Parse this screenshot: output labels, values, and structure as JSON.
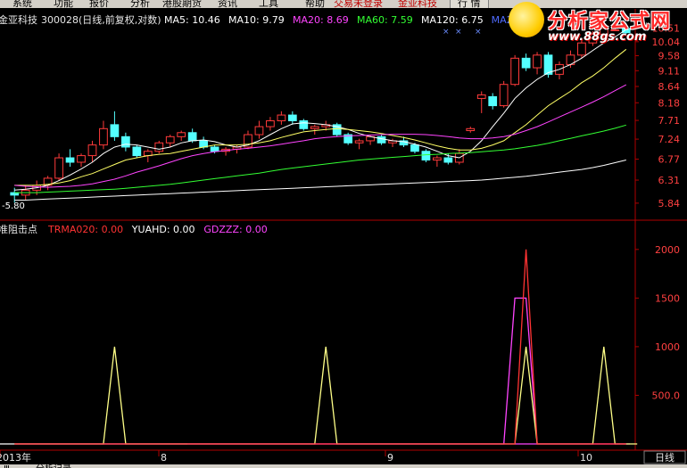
{
  "menu": [
    {
      "label": "系统",
      "x": 14
    },
    {
      "label": "功能",
      "x": 60
    },
    {
      "label": "报价",
      "x": 100
    },
    {
      "label": "分析",
      "x": 146
    },
    {
      "label": "港股期货",
      "x": 182
    },
    {
      "label": "资讯",
      "x": 244
    },
    {
      "label": "工具",
      "x": 290
    },
    {
      "label": "帮助",
      "x": 342
    },
    {
      "label": "交易未登录",
      "x": 374,
      "style": "red"
    },
    {
      "label": "金亚科技",
      "x": 446,
      "style": "red"
    },
    {
      "label": "行 情",
      "x": 504,
      "style": "box"
    }
  ],
  "main_header": {
    "stock": "金亚科技",
    "code_info": "300028(日线,前复权,对数)",
    "items": [
      {
        "label": "MA5: 10.46",
        "color": "#ffffff"
      },
      {
        "label": "MA10: 9.79",
        "color": "#ffffff"
      },
      {
        "label": "MA20: 8.69",
        "color": "#ff44ff"
      },
      {
        "label": "MA60: 7.59",
        "color": "#33ff33"
      },
      {
        "label": "MA120: 6.75",
        "color": "#ffffff"
      },
      {
        "label": "MA250",
        "color": "#4f6bff"
      }
    ]
  },
  "sub_header": {
    "title": "准阻击点",
    "items": [
      {
        "label": "TRMA020: 0.00",
        "color": "#ff3333"
      },
      {
        "label": "YUAHD: 0.00",
        "color": "#ffffff"
      },
      {
        "label": "GDZZZ: 0.00",
        "color": "#ff44ff"
      }
    ]
  },
  "price_axis": [
    "10.51",
    "10.04",
    "9.58",
    "9.11",
    "8.64",
    "8.18",
    "7.71",
    "7.24",
    "6.77",
    "6.31",
    "5.84"
  ],
  "price_low_label": "5.80",
  "ind_axis": [
    "2000",
    "1500",
    "1000",
    "500.0"
  ],
  "time_axis": [
    "2013年",
    "8",
    "9",
    "10"
  ],
  "period_label": "日线",
  "tabs": [
    "Ⅲ",
    "分析记录"
  ],
  "watermark": {
    "name": "分析家公式网",
    "url": "www.88gs.com"
  },
  "colors": {
    "up": "#ff3b3b",
    "down": "#54ffff",
    "ma5": "#ffffff",
    "ma10": "#ffff66",
    "ma20": "#ff44ff",
    "ma60": "#33ff33",
    "ma120": "#ffffff",
    "ma250": "#4f6bff",
    "axis": "#b00000",
    "trma": "#ff3333",
    "yuahd": "#ffff88",
    "gdzzz": "#ff44ff"
  },
  "chart_data": {
    "type": "candlestick",
    "candles": [
      {
        "o": 6.05,
        "h": 6.15,
        "l": 5.85,
        "c": 6.0
      },
      {
        "o": 6.0,
        "h": 6.2,
        "l": 5.9,
        "c": 6.1
      },
      {
        "o": 6.1,
        "h": 6.3,
        "l": 6.0,
        "c": 6.2
      },
      {
        "o": 6.2,
        "h": 6.4,
        "l": 6.1,
        "c": 6.35
      },
      {
        "o": 6.35,
        "h": 6.9,
        "l": 6.3,
        "c": 6.8
      },
      {
        "o": 6.8,
        "h": 7.0,
        "l": 6.6,
        "c": 6.7
      },
      {
        "o": 6.7,
        "h": 6.9,
        "l": 6.6,
        "c": 6.85
      },
      {
        "o": 6.85,
        "h": 7.2,
        "l": 6.7,
        "c": 7.1
      },
      {
        "o": 7.1,
        "h": 7.7,
        "l": 7.0,
        "c": 7.5
      },
      {
        "o": 7.6,
        "h": 7.95,
        "l": 7.2,
        "c": 7.3
      },
      {
        "o": 7.3,
        "h": 7.4,
        "l": 6.95,
        "c": 7.05
      },
      {
        "o": 7.05,
        "h": 7.1,
        "l": 6.8,
        "c": 6.85
      },
      {
        "o": 6.85,
        "h": 7.0,
        "l": 6.7,
        "c": 6.95
      },
      {
        "o": 6.95,
        "h": 7.2,
        "l": 6.9,
        "c": 7.15
      },
      {
        "o": 7.15,
        "h": 7.35,
        "l": 7.05,
        "c": 7.3
      },
      {
        "o": 7.3,
        "h": 7.45,
        "l": 7.2,
        "c": 7.4
      },
      {
        "o": 7.4,
        "h": 7.5,
        "l": 7.15,
        "c": 7.2
      },
      {
        "o": 7.2,
        "h": 7.3,
        "l": 7.0,
        "c": 7.05
      },
      {
        "o": 7.05,
        "h": 7.1,
        "l": 6.9,
        "c": 6.95
      },
      {
        "o": 6.95,
        "h": 7.05,
        "l": 6.85,
        "c": 7.0
      },
      {
        "o": 7.0,
        "h": 7.1,
        "l": 6.9,
        "c": 7.05
      },
      {
        "o": 7.05,
        "h": 7.45,
        "l": 7.0,
        "c": 7.35
      },
      {
        "o": 7.35,
        "h": 7.7,
        "l": 7.25,
        "c": 7.55
      },
      {
        "o": 7.55,
        "h": 7.8,
        "l": 7.45,
        "c": 7.7
      },
      {
        "o": 7.7,
        "h": 7.95,
        "l": 7.6,
        "c": 7.85
      },
      {
        "o": 7.85,
        "h": 7.95,
        "l": 7.6,
        "c": 7.7
      },
      {
        "o": 7.7,
        "h": 7.75,
        "l": 7.45,
        "c": 7.5
      },
      {
        "o": 7.5,
        "h": 7.6,
        "l": 7.35,
        "c": 7.55
      },
      {
        "o": 7.55,
        "h": 7.7,
        "l": 7.45,
        "c": 7.6
      },
      {
        "o": 7.6,
        "h": 7.65,
        "l": 7.3,
        "c": 7.35
      },
      {
        "o": 7.35,
        "h": 7.4,
        "l": 7.1,
        "c": 7.15
      },
      {
        "o": 7.15,
        "h": 7.25,
        "l": 7.0,
        "c": 7.2
      },
      {
        "o": 7.2,
        "h": 7.35,
        "l": 7.1,
        "c": 7.3
      },
      {
        "o": 7.3,
        "h": 7.35,
        "l": 7.1,
        "c": 7.15
      },
      {
        "o": 7.15,
        "h": 7.25,
        "l": 7.05,
        "c": 7.2
      },
      {
        "o": 7.2,
        "h": 7.3,
        "l": 7.05,
        "c": 7.1
      },
      {
        "o": 7.1,
        "h": 7.15,
        "l": 6.9,
        "c": 6.95
      },
      {
        "o": 6.95,
        "h": 7.0,
        "l": 6.7,
        "c": 6.75
      },
      {
        "o": 6.75,
        "h": 6.85,
        "l": 6.6,
        "c": 6.8
      },
      {
        "o": 6.8,
        "h": 6.9,
        "l": 6.65,
        "c": 6.7
      },
      {
        "o": 6.7,
        "h": 7.0,
        "l": 6.65,
        "c": 6.9
      },
      {
        "o": 7.45,
        "h": 7.55,
        "l": 7.4,
        "c": 7.5
      },
      {
        "o": 8.3,
        "h": 8.5,
        "l": 7.9,
        "c": 8.4
      },
      {
        "o": 8.35,
        "h": 8.45,
        "l": 8.0,
        "c": 8.1
      },
      {
        "o": 8.1,
        "h": 8.8,
        "l": 8.05,
        "c": 8.7
      },
      {
        "o": 8.7,
        "h": 9.6,
        "l": 8.65,
        "c": 9.5
      },
      {
        "o": 9.5,
        "h": 9.65,
        "l": 9.1,
        "c": 9.2
      },
      {
        "o": 9.2,
        "h": 9.7,
        "l": 9.0,
        "c": 9.6
      },
      {
        "o": 9.6,
        "h": 9.7,
        "l": 8.9,
        "c": 9.0
      },
      {
        "o": 9.0,
        "h": 9.4,
        "l": 8.85,
        "c": 9.3
      },
      {
        "o": 9.3,
        "h": 9.75,
        "l": 9.2,
        "c": 9.6
      },
      {
        "o": 9.6,
        "h": 10.1,
        "l": 9.5,
        "c": 10.0
      },
      {
        "o": 10.0,
        "h": 10.4,
        "l": 9.9,
        "c": 10.3
      },
      {
        "o": 10.3,
        "h": 10.6,
        "l": 10.1,
        "c": 10.5
      },
      {
        "o": 10.45,
        "h": 10.5,
        "l": 10.45,
        "c": 10.45
      },
      {
        "o": 10.5,
        "h": 10.7,
        "l": 10.3,
        "c": 10.35
      }
    ],
    "ma_lines": [
      {
        "name": "MA5",
        "values": [
          6.1,
          6.12,
          6.15,
          6.2,
          6.3,
          6.42,
          6.55,
          6.7,
          6.9,
          7.05,
          7.12,
          7.1,
          7.05,
          7.0,
          7.05,
          7.15,
          7.2,
          7.22,
          7.18,
          7.1,
          7.05,
          7.1,
          7.2,
          7.35,
          7.5,
          7.62,
          7.65,
          7.63,
          7.6,
          7.55,
          7.48,
          7.38,
          7.3,
          7.25,
          7.2,
          7.18,
          7.12,
          7.05,
          6.95,
          6.85,
          6.8,
          6.95,
          7.2,
          7.55,
          7.9,
          8.3,
          8.6,
          8.85,
          9.05,
          9.15,
          9.3,
          9.5,
          9.75,
          10.0,
          10.2,
          10.46
        ]
      },
      {
        "name": "MA10",
        "values": [
          6.2,
          6.2,
          6.2,
          6.22,
          6.25,
          6.3,
          6.38,
          6.45,
          6.55,
          6.65,
          6.75,
          6.8,
          6.85,
          6.88,
          6.9,
          6.95,
          7.0,
          7.05,
          7.1,
          7.1,
          7.1,
          7.12,
          7.15,
          7.2,
          7.28,
          7.35,
          7.42,
          7.45,
          7.48,
          7.5,
          7.48,
          7.45,
          7.42,
          7.38,
          7.33,
          7.28,
          7.22,
          7.15,
          7.08,
          7.02,
          6.98,
          6.98,
          7.02,
          7.1,
          7.2,
          7.4,
          7.6,
          7.85,
          8.1,
          8.3,
          8.5,
          8.75,
          8.95,
          9.2,
          9.5,
          9.79
        ]
      },
      {
        "name": "MA20",
        "values": [
          6.2,
          6.18,
          6.17,
          6.16,
          6.17,
          6.18,
          6.2,
          6.23,
          6.28,
          6.33,
          6.4,
          6.48,
          6.55,
          6.62,
          6.7,
          6.78,
          6.85,
          6.9,
          6.94,
          6.97,
          7.0,
          7.02,
          7.05,
          7.08,
          7.12,
          7.16,
          7.2,
          7.25,
          7.28,
          7.3,
          7.32,
          7.33,
          7.34,
          7.35,
          7.36,
          7.36,
          7.36,
          7.35,
          7.33,
          7.3,
          7.27,
          7.25,
          7.25,
          7.27,
          7.3,
          7.36,
          7.45,
          7.55,
          7.67,
          7.8,
          7.93,
          8.06,
          8.2,
          8.35,
          8.52,
          8.69
        ]
      },
      {
        "name": "MA60",
        "values": [
          6.05,
          6.05,
          6.05,
          6.06,
          6.07,
          6.08,
          6.09,
          6.1,
          6.11,
          6.12,
          6.14,
          6.16,
          6.18,
          6.2,
          6.22,
          6.25,
          6.28,
          6.31,
          6.34,
          6.37,
          6.4,
          6.43,
          6.46,
          6.5,
          6.54,
          6.57,
          6.6,
          6.63,
          6.66,
          6.69,
          6.72,
          6.75,
          6.77,
          6.79,
          6.81,
          6.83,
          6.85,
          6.87,
          6.88,
          6.9,
          6.91,
          6.92,
          6.94,
          6.96,
          6.98,
          7.01,
          7.05,
          7.09,
          7.14,
          7.2,
          7.26,
          7.32,
          7.38,
          7.44,
          7.51,
          7.59
        ]
      },
      {
        "name": "MA120",
        "values": [
          5.9,
          5.9,
          5.91,
          5.92,
          5.93,
          5.94,
          5.95,
          5.96,
          5.97,
          5.98,
          5.99,
          6.0,
          6.01,
          6.02,
          6.03,
          6.04,
          6.05,
          6.06,
          6.07,
          6.08,
          6.09,
          6.1,
          6.11,
          6.12,
          6.13,
          6.14,
          6.15,
          6.16,
          6.17,
          6.18,
          6.19,
          6.2,
          6.21,
          6.22,
          6.23,
          6.24,
          6.25,
          6.26,
          6.27,
          6.28,
          6.29,
          6.3,
          6.31,
          6.33,
          6.35,
          6.37,
          6.39,
          6.42,
          6.45,
          6.48,
          6.51,
          6.54,
          6.58,
          6.63,
          6.69,
          6.75
        ]
      }
    ],
    "indicator": {
      "ylim": [
        0,
        2200
      ],
      "trma020": [
        0,
        0,
        0,
        0,
        0,
        0,
        0,
        0,
        0,
        0,
        0,
        0,
        0,
        0,
        0,
        0,
        0,
        0,
        0,
        0,
        0,
        0,
        0,
        0,
        0,
        0,
        0,
        0,
        0,
        0,
        0,
        0,
        0,
        0,
        0,
        0,
        0,
        0,
        0,
        0,
        0,
        0,
        0,
        0,
        0,
        0,
        2000,
        0,
        0,
        0,
        0,
        0,
        0,
        0,
        0,
        0
      ],
      "yuahd": [
        0,
        0,
        0,
        0,
        0,
        0,
        0,
        0,
        0,
        1000,
        0,
        0,
        0,
        0,
        0,
        0,
        0,
        0,
        0,
        0,
        0,
        0,
        0,
        0,
        0,
        0,
        0,
        0,
        1000,
        0,
        0,
        0,
        0,
        0,
        0,
        0,
        0,
        0,
        0,
        0,
        0,
        0,
        0,
        0,
        0,
        0,
        1000,
        0,
        0,
        0,
        0,
        0,
        0,
        1000,
        0,
        0,
        0
      ],
      "gdzzz": [
        0,
        0,
        0,
        0,
        0,
        0,
        0,
        0,
        0,
        0,
        0,
        0,
        0,
        0,
        0,
        0,
        0,
        0,
        0,
        0,
        0,
        0,
        0,
        0,
        0,
        0,
        0,
        0,
        0,
        0,
        0,
        0,
        0,
        0,
        0,
        0,
        0,
        0,
        0,
        0,
        0,
        0,
        0,
        0,
        0,
        1500,
        1500,
        0,
        0,
        0,
        0,
        0,
        0,
        0,
        0,
        0
      ]
    }
  }
}
